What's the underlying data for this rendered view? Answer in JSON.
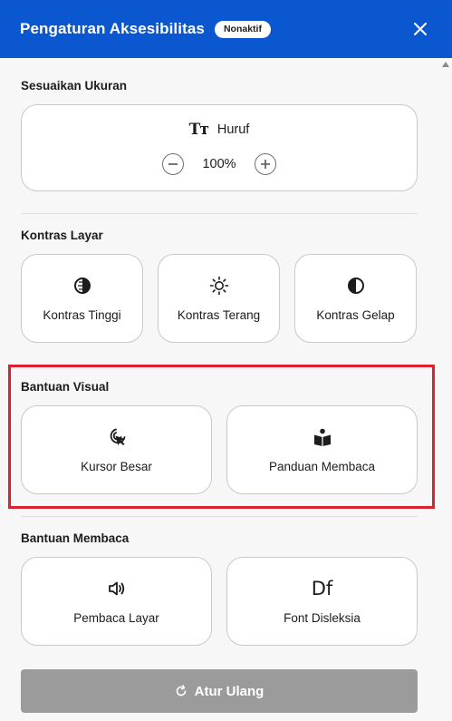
{
  "header": {
    "title": "Pengaturan Aksesibilitas",
    "status": "Nonaktif",
    "close_icon": "close-icon"
  },
  "size_section": {
    "label": "Sesuaikan Ukuran",
    "font_card": {
      "icon": "text-size-icon",
      "icon_glyph": "Tт",
      "label": "Huruf",
      "zoom": "100%"
    }
  },
  "contrast_section": {
    "label": "Kontras Layar",
    "items": [
      {
        "label": "Kontras Tinggi",
        "icon": "high-contrast-icon"
      },
      {
        "label": "Kontras Terang",
        "icon": "sun-icon"
      },
      {
        "label": "Kontras Gelap",
        "icon": "dark-contrast-icon"
      }
    ]
  },
  "visual_section": {
    "label": "Bantuan Visual",
    "items": [
      {
        "label": "Kursor Besar",
        "icon": "cursor-icon"
      },
      {
        "label": "Panduan Membaca",
        "icon": "book-reader-icon"
      }
    ]
  },
  "reading_section": {
    "label": "Bantuan Membaca",
    "items": [
      {
        "label": "Pembaca Layar",
        "icon": "speaker-icon"
      },
      {
        "label": "Font Disleksia",
        "icon": "dyslexia-font-icon",
        "icon_glyph": "Df"
      }
    ]
  },
  "reset": {
    "label": "Atur Ulang",
    "icon": "refresh-icon"
  },
  "colors": {
    "header_bg": "#0b57d0",
    "highlight": "#e0202e",
    "reset_bg": "#9b9b9b"
  }
}
